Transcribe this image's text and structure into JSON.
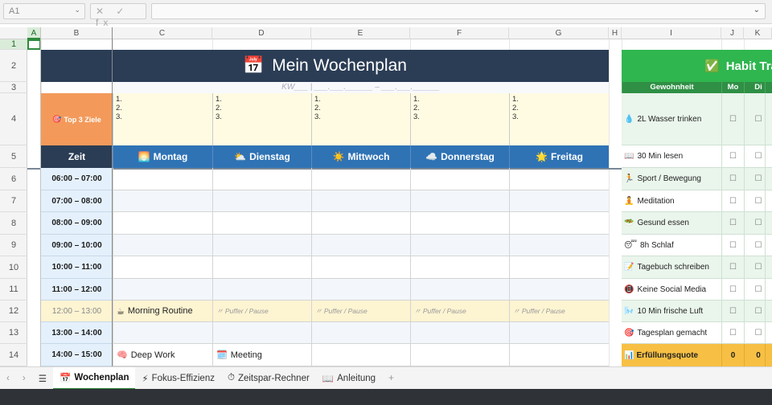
{
  "formula_bar": {
    "cell_ref": "A1",
    "tools": "✕ ✓ fx"
  },
  "columns": [
    "A",
    "B",
    "C",
    "D",
    "E",
    "F",
    "G",
    "H",
    "I",
    "J",
    "K"
  ],
  "rows": [
    "1",
    "2",
    "3",
    "4",
    "5",
    "6",
    "7",
    "8",
    "9",
    "10",
    "11",
    "12",
    "13",
    "14"
  ],
  "planner": {
    "title": "Mein Wochenplan",
    "title_icon": "📅",
    "kw_line": "KW___ | ___.___.______ – ___.___.______",
    "goals_label": "Top 3 Ziele",
    "goals_icon": "🎯",
    "goal_lines": [
      "1.\n2.\n3.",
      "1.\n2.\n3.",
      "1.\n2.\n3.",
      "1.\n2.\n3.",
      "1.\n2.\n3."
    ],
    "time_header": "Zeit",
    "days": [
      {
        "icon": "🌅",
        "label": "Montag"
      },
      {
        "icon": "⛅",
        "label": "Dienstag"
      },
      {
        "icon": "☀️",
        "label": "Mittwoch"
      },
      {
        "icon": "☁️",
        "label": "Donnerstag"
      },
      {
        "icon": "🌟",
        "label": "Freitag"
      }
    ],
    "times": [
      "06:00 – 07:00",
      "07:00 – 08:00",
      "08:00 – 09:00",
      "09:00 – 10:00",
      "10:00 – 11:00",
      "11:00 – 12:00",
      "12:00 – 13:00",
      "13:00 – 14:00",
      "14:00 – 15:00"
    ],
    "events": {
      "morning_routine": {
        "icon": "☕",
        "label": "Morning Routine"
      },
      "pause_label": "〃 Puffer / Pause",
      "deep_work": {
        "icon": "🧠",
        "label": "Deep Work"
      },
      "meeting": {
        "icon": "🗓️",
        "label": "Meeting"
      }
    }
  },
  "habits": {
    "title": "Habit Tra",
    "title_icon": "✅",
    "col_label": "Gewohnheit",
    "day_cols": [
      "Mo",
      "Di"
    ],
    "items": [
      {
        "icon": "💧",
        "label": "2L Wasser trinken"
      },
      {
        "icon": "📖",
        "label": "30 Min lesen"
      },
      {
        "icon": "🏃",
        "label": "Sport / Bewegung"
      },
      {
        "icon": "🧘",
        "label": "Meditation"
      },
      {
        "icon": "🥗",
        "label": "Gesund essen"
      },
      {
        "icon": "😴",
        "label": "8h Schlaf"
      },
      {
        "icon": "📝",
        "label": "Tagebuch schreiben"
      },
      {
        "icon": "📵",
        "label": "Keine Social Media"
      },
      {
        "icon": "🌬️",
        "label": "10 Min frische Luft"
      },
      {
        "icon": "🎯",
        "label": "Tagesplan gemacht"
      }
    ],
    "checkbox": "☐",
    "quote_label": "Erfüllungsquote",
    "quote_icon": "📊",
    "quote_values": [
      "0",
      "0"
    ]
  },
  "sheet_tabs": [
    {
      "icon": "📅",
      "label": "Wochenplan"
    },
    {
      "icon": "⚡",
      "label": "Fokus-Effizienz"
    },
    {
      "icon": "⏱",
      "label": "Zeitspar-Rechner"
    },
    {
      "icon": "📖",
      "label": "Anleitung"
    }
  ]
}
